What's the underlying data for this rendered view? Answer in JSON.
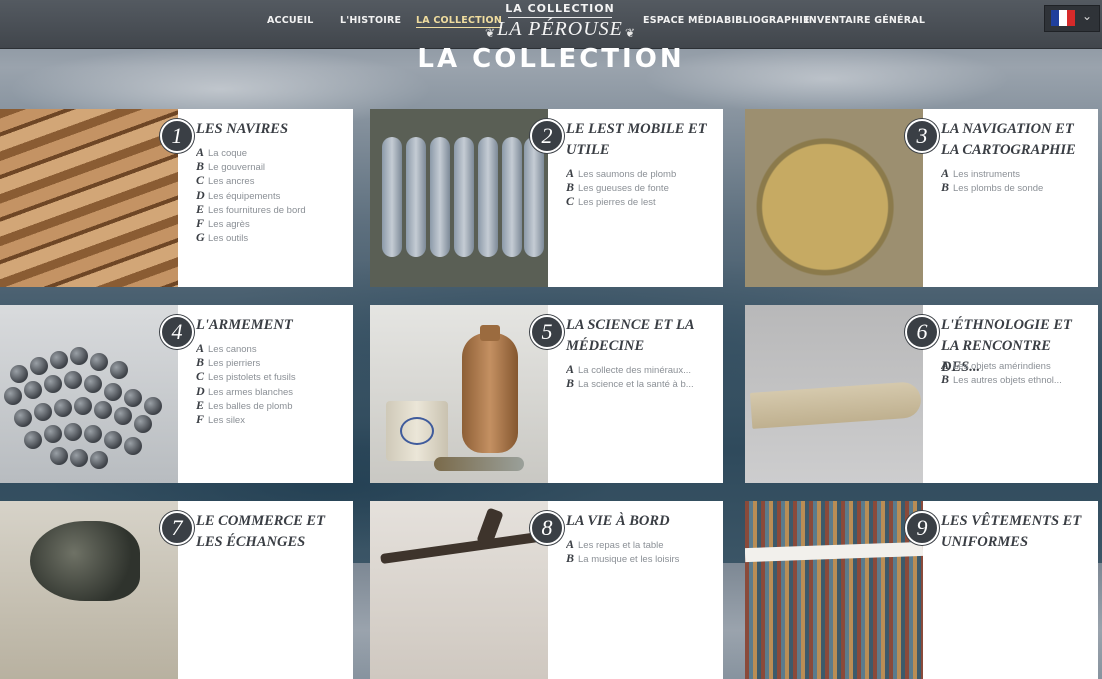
{
  "nav": {
    "items": [
      "ACCUEIL",
      "L'HISTOIRE",
      "LA COLLECTION",
      "ESPACE MÉDIA",
      "BIBLIOGRAPHIE",
      "INVENTAIRE GÉNÉRAL"
    ],
    "active": "LA COLLECTION",
    "logo_top": "LA COLLECTION",
    "logo_main": "LA PÉROUSE",
    "lang_flag_colors": [
      "#1f3f9c",
      "#ffffff",
      "#d62a2a"
    ]
  },
  "page_title": "LA COLLECTION",
  "cards": [
    {
      "num": "1",
      "title": "LES NAVIRES",
      "items": [
        {
          "letter": "A",
          "label": "La coque"
        },
        {
          "letter": "B",
          "label": "Le gouvernail"
        },
        {
          "letter": "C",
          "label": "Les ancres"
        },
        {
          "letter": "D",
          "label": "Les équipements"
        },
        {
          "letter": "E",
          "label": "Les fournitures de bord"
        },
        {
          "letter": "F",
          "label": "Les agrès"
        },
        {
          "letter": "G",
          "label": "Les outils"
        }
      ]
    },
    {
      "num": "2",
      "title": "LE LEST MOBILE ET UTILE",
      "items": [
        {
          "letter": "A",
          "label": "Les saumons de plomb"
        },
        {
          "letter": "B",
          "label": "Les gueuses de fonte"
        },
        {
          "letter": "C",
          "label": "Les pierres de lest"
        }
      ]
    },
    {
      "num": "3",
      "title": "LA NAVIGATION ET LA CARTOGRAPHIE",
      "items": [
        {
          "letter": "A",
          "label": "Les instruments"
        },
        {
          "letter": "B",
          "label": "Les plombs de sonde"
        }
      ]
    },
    {
      "num": "4",
      "title": "L'ARMEMENT",
      "items": [
        {
          "letter": "A",
          "label": "Les canons"
        },
        {
          "letter": "B",
          "label": "Les pierriers"
        },
        {
          "letter": "C",
          "label": "Les pistolets et fusils"
        },
        {
          "letter": "D",
          "label": "Les armes blanches"
        },
        {
          "letter": "E",
          "label": "Les balles de plomb"
        },
        {
          "letter": "F",
          "label": "Les silex"
        }
      ]
    },
    {
      "num": "5",
      "title": "LA SCIENCE ET LA MÉDECINE",
      "items": [
        {
          "letter": "A",
          "label": "La collecte des minéraux..."
        },
        {
          "letter": "B",
          "label": "La science et la santé à b..."
        }
      ]
    },
    {
      "num": "6",
      "title": "L'ÉTHNOLOGIE ET LA RENCONTRE DES...",
      "items": [
        {
          "letter": "A",
          "label": "Les objets amérindiens"
        },
        {
          "letter": "B",
          "label": "Les autres objets ethnol..."
        }
      ]
    },
    {
      "num": "7",
      "title": "LE COMMERCE ET LES ÉCHANGES",
      "items": []
    },
    {
      "num": "8",
      "title": "LA VIE À BORD",
      "items": [
        {
          "letter": "A",
          "label": "Les repas et la table"
        },
        {
          "letter": "B",
          "label": "La musique et les loisirs"
        }
      ]
    },
    {
      "num": "9",
      "title": "LES VÊTEMENTS ET UNIFORMES",
      "items": []
    }
  ]
}
